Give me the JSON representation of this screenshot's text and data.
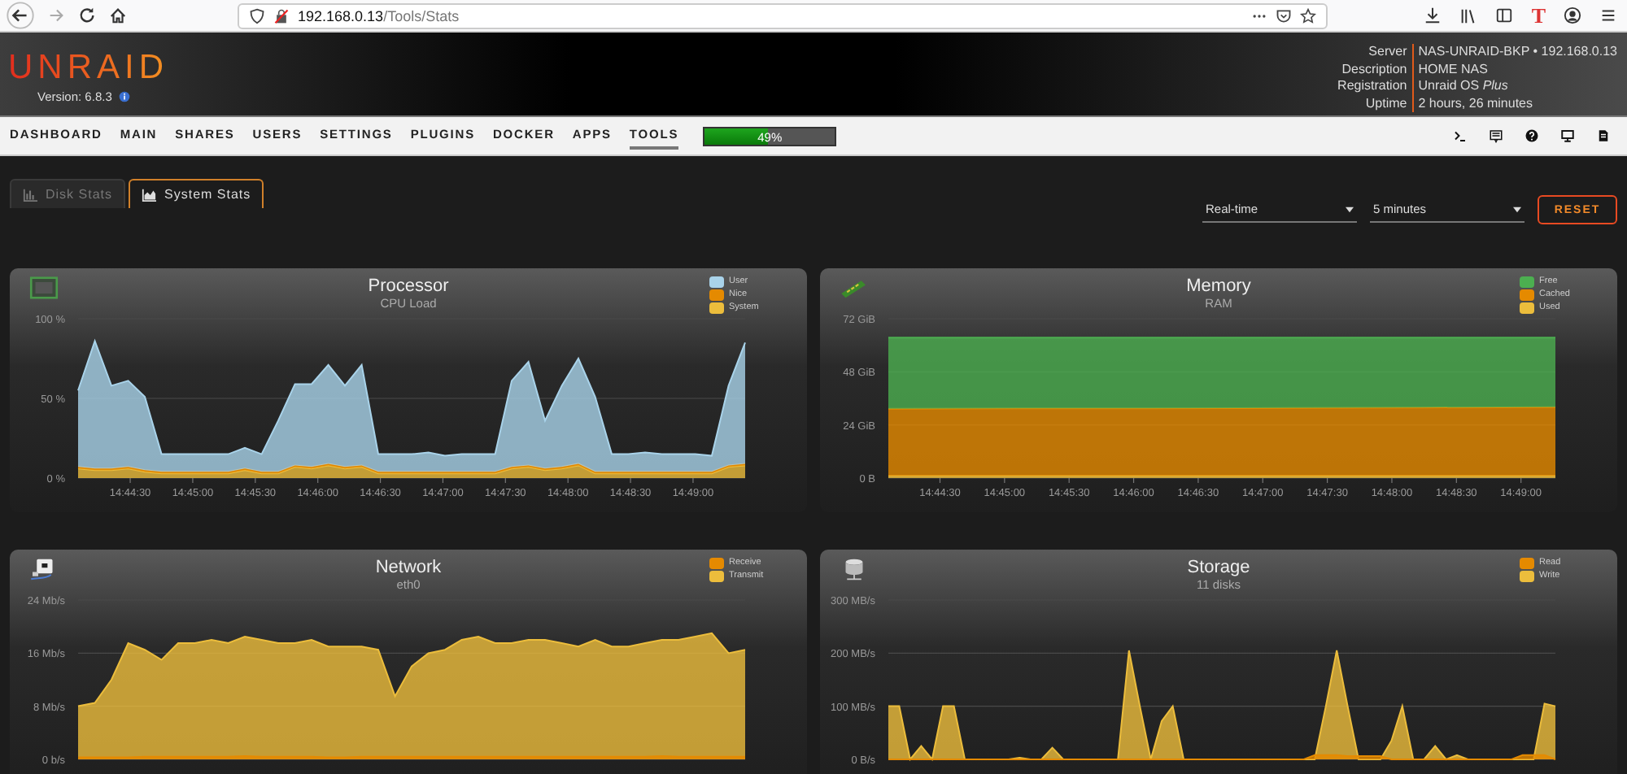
{
  "browser": {
    "url_host": "192.168.0.13",
    "url_path": "/Tools/Stats",
    "extension_label": "T"
  },
  "header": {
    "logo": "UNRAID",
    "version": "Version: 6.8.3",
    "info": [
      {
        "label": "Server",
        "value": "NAS-UNRAID-BKP • 192.168.0.13"
      },
      {
        "label": "Description",
        "value": "HOME NAS"
      },
      {
        "label": "Registration",
        "value": "Unraid OS *Plus*"
      },
      {
        "label": "Uptime",
        "value": "2 hours, 26 minutes"
      }
    ]
  },
  "nav": {
    "items": [
      {
        "label": "DASHBOARD",
        "selected": false
      },
      {
        "label": "MAIN",
        "selected": false
      },
      {
        "label": "SHARES",
        "selected": false
      },
      {
        "label": "USERS",
        "selected": false
      },
      {
        "label": "SETTINGS",
        "selected": false
      },
      {
        "label": "PLUGINS",
        "selected": false
      },
      {
        "label": "DOCKER",
        "selected": false
      },
      {
        "label": "APPS",
        "selected": false
      },
      {
        "label": "TOOLS",
        "selected": true
      }
    ],
    "progress": {
      "label": "49%",
      "level": 0.49
    }
  },
  "tabs": [
    {
      "label": "Disk Stats",
      "selected": false
    },
    {
      "label": "System Stats",
      "selected": true
    }
  ],
  "controls": {
    "range": "Real-time",
    "interval": "5 minutes",
    "reset": "RESET"
  },
  "cards": [
    {
      "title": "Processor",
      "subtitle": "CPU Load",
      "chart_data": {
        "type": "area",
        "stacked": true,
        "x": [
          53045,
          53053,
          53061,
          53069,
          53077,
          53085,
          53093,
          53101,
          53109,
          53117,
          53125,
          53133,
          53141,
          53149,
          53157,
          53165,
          53173,
          53181,
          53189,
          53197,
          53205,
          53213,
          53221,
          53229,
          53237,
          53245,
          53253,
          53261,
          53269,
          53277,
          53285,
          53293,
          53301,
          53309,
          53317,
          53325,
          53333,
          53341,
          53349,
          53357,
          53365
        ],
        "xlim": [
          53045,
          53365
        ],
        "ylim": [
          0,
          100
        ],
        "yticks": [
          {
            "value": 0,
            "label": "0 %"
          },
          {
            "value": 50,
            "label": "50 %"
          },
          {
            "value": 100,
            "label": "100 %"
          }
        ],
        "xticks": [
          {
            "value": 53070,
            "label": "14:44:30"
          },
          {
            "value": 53100,
            "label": "14:45:00"
          },
          {
            "value": 53130,
            "label": "14:45:30"
          },
          {
            "value": 53160,
            "label": "14:46:00"
          },
          {
            "value": 53190,
            "label": "14:46:30"
          },
          {
            "value": 53220,
            "label": "14:47:00"
          },
          {
            "value": 53250,
            "label": "14:47:30"
          },
          {
            "value": 53280,
            "label": "14:48:00"
          },
          {
            "value": 53310,
            "label": "14:48:30"
          },
          {
            "value": 53340,
            "label": "14:49:00"
          }
        ],
        "series": [
          {
            "name": "System",
            "color": "#ecbd3c",
            "values": [
              6,
              5,
              5,
              6,
              4,
              3,
              3,
              3,
              3,
              3,
              5,
              3,
              3,
              7,
              6,
              8,
              6,
              7,
              3,
              3,
              3,
              3,
              3,
              3,
              3,
              3,
              6,
              7,
              5,
              6,
              8,
              3,
              3,
              3,
              3,
              3,
              3,
              3,
              3,
              7,
              8
            ]
          },
          {
            "name": "Nice",
            "color": "#e58a00",
            "values": [
              1,
              1,
              1,
              1,
              1,
              1,
              1,
              1,
              1,
              1,
              1,
              1,
              1,
              1,
              1,
              1,
              1,
              1,
              1,
              1,
              1,
              1,
              1,
              1,
              1,
              1,
              1,
              1,
              1,
              1,
              1,
              1,
              1,
              1,
              1,
              1,
              1,
              1,
              1,
              1,
              1
            ]
          },
          {
            "name": "User",
            "color": "#a9d3ea",
            "values": [
              48,
              80,
              52,
              54,
              46,
              11,
              11,
              11,
              11,
              11,
              13,
              11,
              32,
              51,
              52,
              62,
              51,
              63,
              11,
              11,
              11,
              12,
              10,
              11,
              11,
              11,
              54,
              65,
              30,
              51,
              66,
              47,
              11,
              11,
              12,
              11,
              11,
              11,
              10,
              50,
              76
            ]
          }
        ]
      }
    },
    {
      "title": "Memory",
      "subtitle": "RAM",
      "chart_data": {
        "type": "area",
        "stacked": true,
        "x": [
          53046,
          53108,
          53170,
          53232,
          53294,
          53356
        ],
        "xlim": [
          53046,
          53356
        ],
        "ylim": [
          0,
          72
        ],
        "yticks": [
          {
            "value": 0,
            "label": "0 B"
          },
          {
            "value": 24,
            "label": "24 GiB"
          },
          {
            "value": 48,
            "label": "48 GiB"
          },
          {
            "value": 72,
            "label": "72 GiB"
          }
        ],
        "xticks": [
          {
            "value": 53070,
            "label": "14:44:30"
          },
          {
            "value": 53100,
            "label": "14:45:00"
          },
          {
            "value": 53130,
            "label": "14:45:30"
          },
          {
            "value": 53160,
            "label": "14:46:00"
          },
          {
            "value": 53190,
            "label": "14:46:30"
          },
          {
            "value": 53220,
            "label": "14:47:00"
          },
          {
            "value": 53250,
            "label": "14:47:30"
          },
          {
            "value": 53280,
            "label": "14:48:00"
          },
          {
            "value": 53310,
            "label": "14:48:30"
          },
          {
            "value": 53340,
            "label": "14:49:00"
          }
        ],
        "series": [
          {
            "name": "Used",
            "color": "#ecbd3c",
            "values": [
              1,
              1,
              1,
              1,
              1,
              1
            ]
          },
          {
            "name": "Cached",
            "color": "#e58a00",
            "values": [
              30.3,
              30.5,
              30.5,
              30.7,
              30.9,
              31
            ]
          },
          {
            "name": "Free",
            "color": "#4caf50",
            "values": [
              32.2,
              32,
              32,
              31.8,
              31.6,
              31.5
            ]
          }
        ]
      }
    },
    {
      "title": "Network",
      "subtitle": "eth0",
      "chart_data": {
        "type": "area",
        "ylim": [
          0,
          24
        ],
        "yticks": [
          {
            "value": 0,
            "label": "0 b/s"
          },
          {
            "value": 8,
            "label": "8 Mb/s"
          },
          {
            "value": 16,
            "label": "16 Mb/s"
          },
          {
            "value": 24,
            "label": "24 Mb/s"
          }
        ],
        "series": [
          {
            "name": "Receive",
            "color": "#e58a00",
            "values": [
              0.3,
              0.3,
              0.3,
              0.3,
              0.4,
              0.4,
              0.4,
              0.4,
              0.4,
              0.4,
              0.5,
              0.4,
              0.4,
              0.4,
              0.4,
              0.3,
              0.3,
              0.4,
              0.4,
              0.4,
              0.4,
              0.4,
              0.4,
              0.4,
              0.4,
              0.4,
              0.4,
              0.4,
              0.4,
              0.4,
              0.4,
              0.4,
              0.4,
              0.4,
              0.4,
              0.5,
              0.4,
              0.4,
              0.4,
              0.4,
              0.4
            ]
          },
          {
            "name": "Transmit",
            "color": "#ecbd3c",
            "values": [
              8,
              8.5,
              12,
              17.5,
              16.5,
              15,
              17.5,
              17.5,
              18,
              17.5,
              18.5,
              18,
              17.5,
              17.5,
              18,
              17,
              17,
              17,
              16.5,
              9.5,
              14,
              16,
              16.5,
              18,
              18.5,
              17.5,
              17.5,
              18,
              18,
              17.5,
              17,
              18,
              17,
              17,
              17.5,
              18,
              18,
              18.5,
              19,
              16,
              16.5
            ]
          }
        ]
      }
    },
    {
      "title": "Storage",
      "subtitle": "11 disks",
      "chart_data": {
        "type": "area",
        "ylim": [
          0,
          300
        ],
        "yticks": [
          {
            "value": 0,
            "label": "0 B/s"
          },
          {
            "value": 100,
            "label": "100 MB/s"
          },
          {
            "value": 200,
            "label": "200 MB/s"
          },
          {
            "value": 300,
            "label": "300 MB/s"
          }
        ],
        "series": [
          {
            "name": "Read",
            "color": "#e58a00",
            "values": [
              0,
              0,
              0,
              0,
              0,
              0,
              0,
              0,
              0,
              0,
              0,
              0,
              0,
              0,
              0,
              0,
              0,
              0,
              0,
              0,
              0,
              0,
              0,
              0,
              0,
              0,
              0,
              0,
              0,
              0,
              0,
              0,
              0,
              0,
              0,
              0,
              0,
              0,
              0,
              8,
              8,
              8,
              6,
              6,
              6,
              6,
              0,
              0,
              0,
              0,
              0,
              0,
              0,
              0,
              0,
              0,
              0,
              0,
              8,
              8,
              8,
              0
            ]
          },
          {
            "name": "Write",
            "color": "#ecbd3c",
            "values": [
              100,
              100,
              0,
              25,
              0,
              100,
              100,
              0,
              0,
              0,
              0,
              0,
              3,
              0,
              0,
              22,
              0,
              0,
              0,
              0,
              0,
              0,
              205,
              100,
              0,
              72,
              100,
              0,
              0,
              0,
              0,
              0,
              0,
              0,
              0,
              0,
              0,
              0,
              0,
              0,
              100,
              205,
              100,
              0,
              0,
              0,
              35,
              100,
              0,
              0,
              25,
              0,
              8,
              0,
              0,
              0,
              0,
              0,
              0,
              0,
              105,
              100
            ]
          }
        ]
      }
    }
  ]
}
